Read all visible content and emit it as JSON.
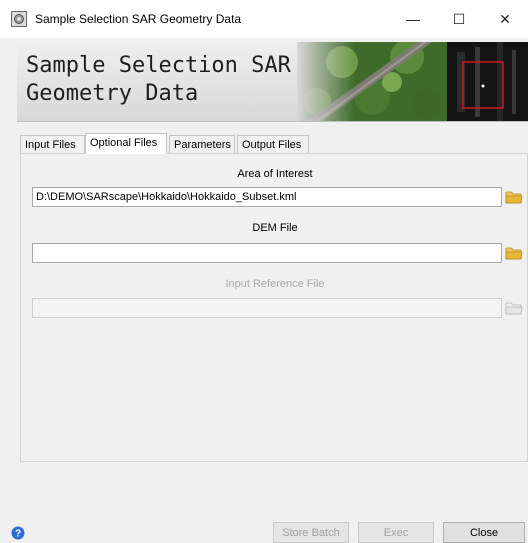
{
  "window": {
    "title": "Sample Selection SAR Geometry Data",
    "minimize_glyph": "—",
    "maximize_glyph": "☐",
    "close_glyph": "✕"
  },
  "banner": {
    "title_line1": "Sample Selection SAR",
    "title_line2": "Geometry Data"
  },
  "tabs": [
    {
      "label": "Input Files",
      "active": false
    },
    {
      "label": "Optional Files",
      "active": true
    },
    {
      "label": "Parameters",
      "active": false
    },
    {
      "label": "Output Files",
      "active": false
    }
  ],
  "fields": {
    "area_of_interest": {
      "label": "Area of Interest",
      "value": "D:\\DEMO\\SARscape\\Hokkaido\\Hokkaido_Subset.kml",
      "enabled": true
    },
    "dem_file": {
      "label": "DEM File",
      "value": "",
      "enabled": true
    },
    "input_reference_file": {
      "label": "Input Reference File",
      "value": "",
      "enabled": false
    }
  },
  "buttons": {
    "store_batch": "Store Batch",
    "exec": "Exec",
    "close": "Close"
  },
  "icons": {
    "app": "app-icon",
    "folder": "folder-icon",
    "help": "help-icon"
  },
  "colors": {
    "folder": "#e8b73a",
    "help": "#2b6fd6",
    "disabled_text": "#a8a8a8"
  }
}
